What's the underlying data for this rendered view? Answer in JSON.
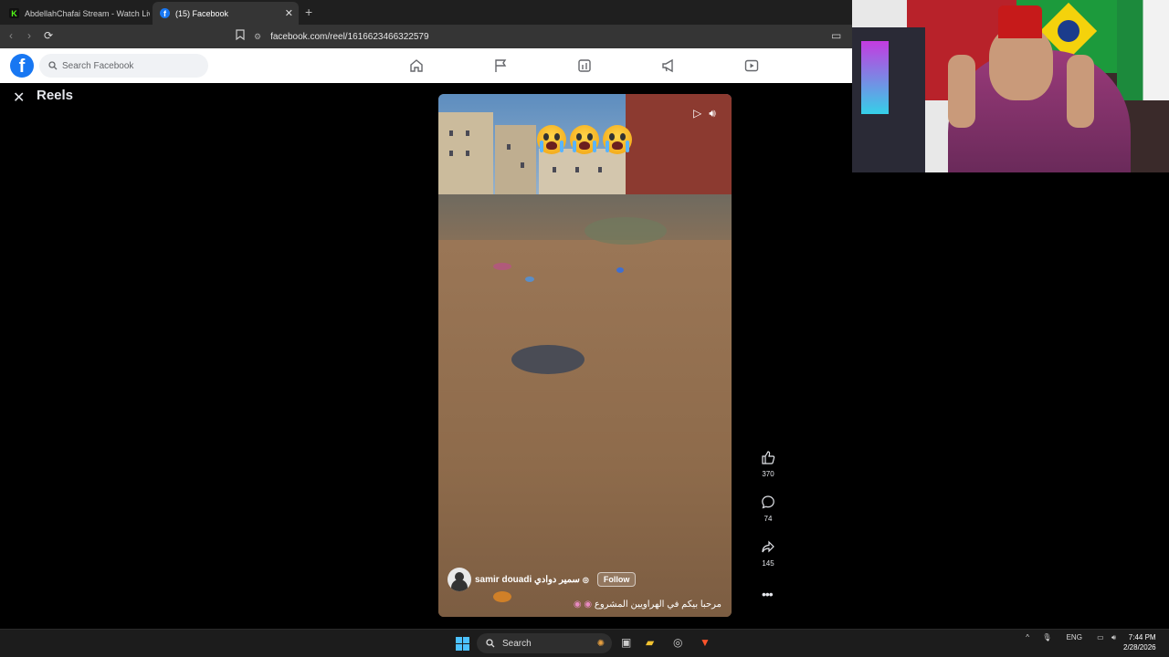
{
  "browser": {
    "tabs": [
      {
        "label": "AbdellahChafai Stream - Watch Live",
        "active": false,
        "icon": "kick-icon"
      },
      {
        "label": "(15) Facebook",
        "active": true,
        "icon": "facebook-icon"
      }
    ],
    "url": "facebook.com/reel/1616623466322579"
  },
  "facebook": {
    "search_placeholder": "Search Facebook",
    "nav_icons": [
      "home-icon",
      "flag-icon",
      "marketplace-icon",
      "megaphone-icon",
      "video-icon"
    ],
    "brand_color": "#1877f2"
  },
  "reels": {
    "title": "Reels",
    "author_name": "samir douadi سمير دوادي",
    "follow_label": "Follow",
    "caption": "مرحبا بيكم في الهراويين المشروع",
    "likes": "370",
    "comments": "74",
    "shares": "145"
  },
  "taskbar": {
    "search_label": "Search",
    "language": "ENG",
    "time": "7:44 PM",
    "date": "2/28/2026"
  }
}
